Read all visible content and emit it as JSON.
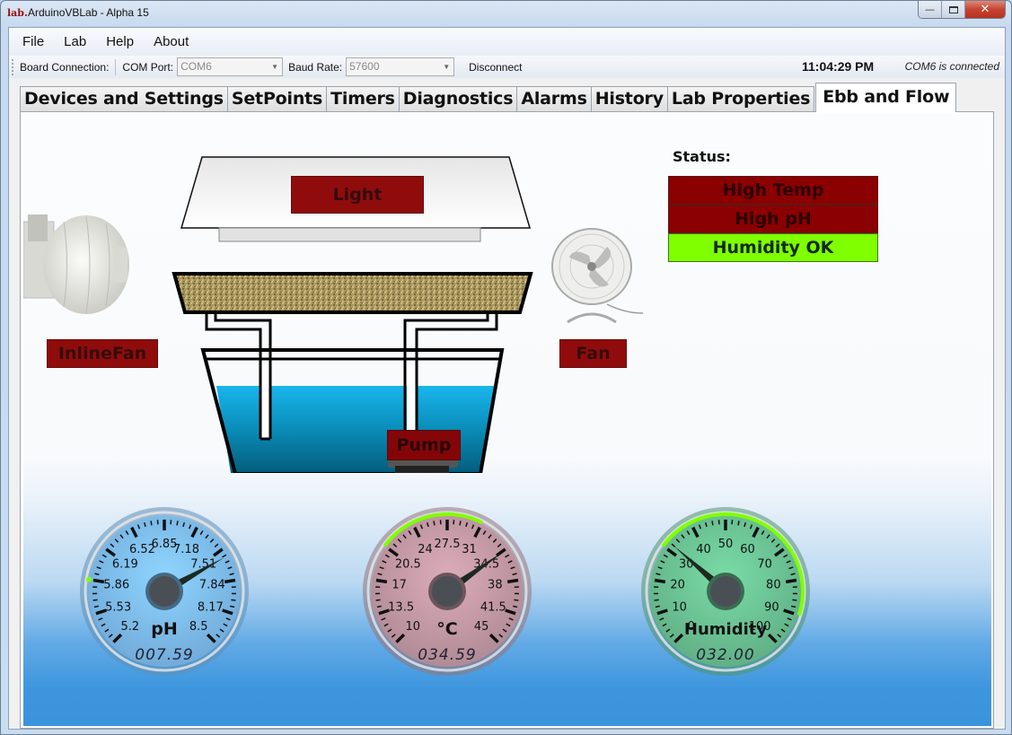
{
  "window": {
    "logo_text": "lab.",
    "title": "ArduinoVBLab - Alpha 15",
    "controls": {
      "minimize": "—",
      "maximize": "▫",
      "close": "✕"
    }
  },
  "menu": [
    "File",
    "Lab",
    "Help",
    "About"
  ],
  "toolbar": {
    "board_connection_label": "Board Connection:",
    "com_port_label": "COM Port:",
    "com_port_value": "COM6",
    "baud_rate_label": "Baud Rate:",
    "baud_rate_value": "57600",
    "disconnect_label": "Disconnect",
    "clock": "11:04:29 PM",
    "connection_status": "COM6 is connected"
  },
  "tabs": [
    "Devices and Settings",
    "SetPoints",
    "Timers",
    "Diagnostics",
    "Alarms",
    "History",
    "Lab Properties",
    "Ebb and Flow"
  ],
  "active_tab": "Ebb and Flow",
  "devices": {
    "light": "Light",
    "inline_fan": "InlineFan",
    "fan": "Fan",
    "pump": "Pump",
    "device_off_color": "#8b0000"
  },
  "status": {
    "title": "Status:",
    "items": [
      {
        "label": "High Temp",
        "state": "bad"
      },
      {
        "label": "High pH",
        "state": "bad"
      },
      {
        "label": "Humidity OK",
        "state": "ok"
      }
    ],
    "bad_color": "#8b0000",
    "ok_color": "#7fff00"
  },
  "gauges": [
    {
      "name": "ph",
      "unit_label": "pH",
      "min": 5.2,
      "max": 8.5,
      "tick_labels": [
        "5.2",
        "5.53",
        "5.86",
        "6.19",
        "6.52",
        "6.85",
        "7.18",
        "7.51",
        "7.84",
        "8.17",
        "8.5"
      ],
      "value": 7.59,
      "readout": "007.59",
      "face_color": "#7fbef2",
      "ok_range": [
        5.86,
        5.86
      ]
    },
    {
      "name": "temperature",
      "unit_label": "°C",
      "min": 10,
      "max": 45,
      "tick_labels": [
        "10",
        "13.5",
        "17",
        "20.5",
        "24",
        "27.5",
        "31",
        "34.5",
        "38",
        "41.5",
        "45"
      ],
      "value": 34.59,
      "readout": "034.59",
      "face_color": "#c49aa5",
      "ok_range": [
        20.5,
        31
      ]
    },
    {
      "name": "humidity",
      "unit_label": "Humidity",
      "min": 0,
      "max": 100,
      "tick_labels": [
        "0",
        "10",
        "20",
        "30",
        "40",
        "50",
        "60",
        "70",
        "80",
        "90",
        "100"
      ],
      "value": 32.0,
      "readout": "032.00",
      "face_color": "#6cc495",
      "ok_range": [
        30,
        90
      ]
    }
  ]
}
